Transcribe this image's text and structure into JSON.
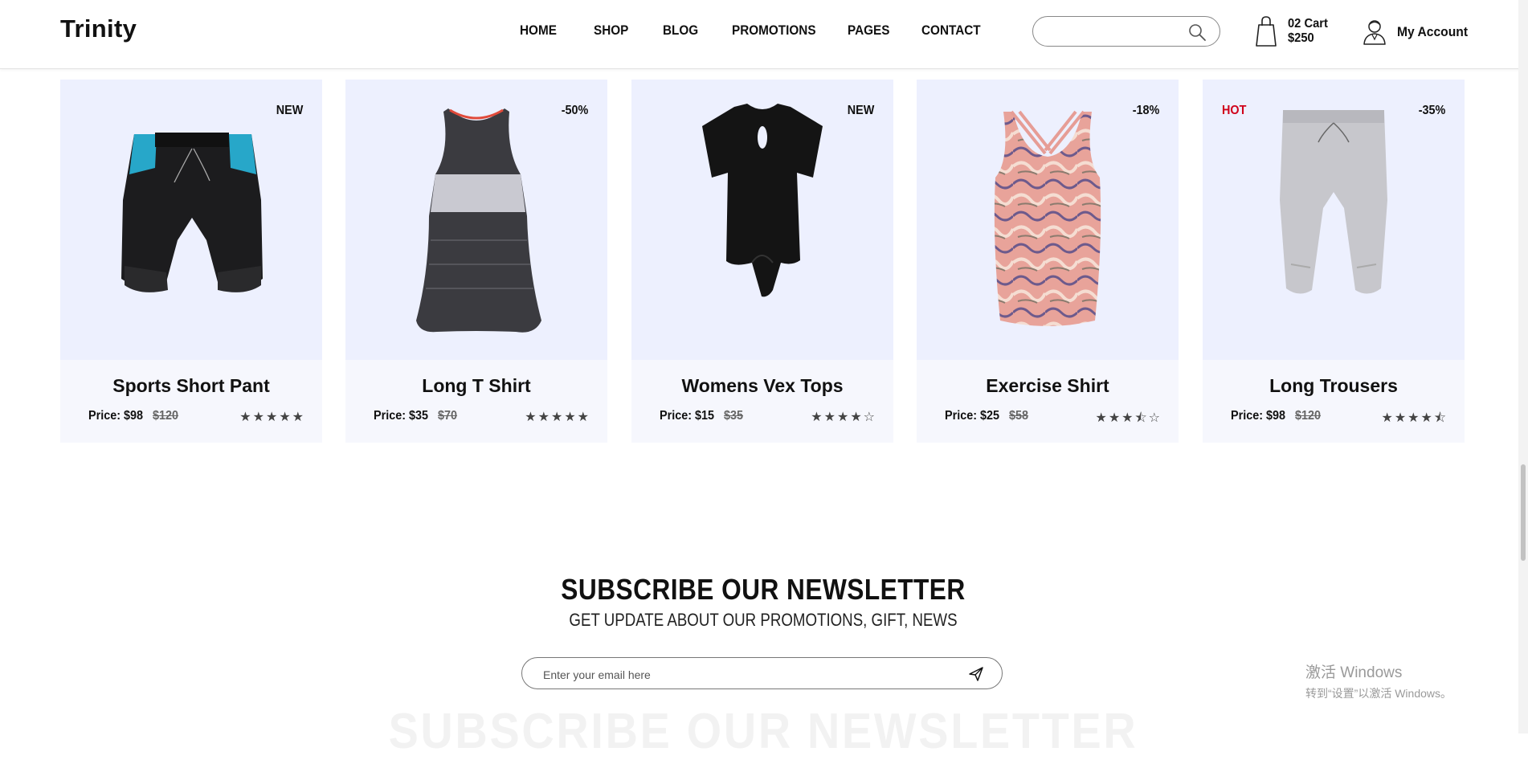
{
  "header": {
    "logo": "Trinity",
    "nav": [
      "HOME",
      "SHOP",
      "BLOG",
      "PROMOTIONS",
      "PAGES",
      "CONTACT"
    ],
    "search_placeholder": "",
    "cart_count": "02 Cart",
    "cart_total": "$250",
    "account_label": "My Account"
  },
  "products": [
    {
      "badge": "NEW",
      "badge_left": "",
      "name": "Sports Short Pant",
      "price": "Price: $98",
      "old_price": "$120",
      "rating": 5
    },
    {
      "badge": "-50%",
      "badge_left": "",
      "name": "Long T Shirt",
      "price": "Price: $35",
      "old_price": "$70",
      "rating": 5
    },
    {
      "badge": "NEW",
      "badge_left": "",
      "name": "Womens Vex Tops",
      "price": "Price: $15",
      "old_price": "$35",
      "rating": 4
    },
    {
      "badge": "-18%",
      "badge_left": "",
      "name": "Exercise Shirt",
      "price": "Price: $25",
      "old_price": "$58",
      "rating": 3.5
    },
    {
      "badge": "-35%",
      "badge_left": "HOT",
      "name": "Long Trousers",
      "price": "Price: $98",
      "old_price": "$120",
      "rating": 4.5
    }
  ],
  "newsletter": {
    "title": "SUBSCRIBE OUR NEWSLETTER",
    "subtitle": "GET UPDATE ABOUT OUR PROMOTIONS, GIFT, NEWS",
    "email_placeholder": "Enter your email here",
    "ghost_title": "SUBSCRIBE OUR NEWSLETTER"
  },
  "watermark": {
    "line1": "激活 Windows",
    "line2": "转到“设置”以激活 Windows。"
  },
  "colors": {
    "card_image_bg": "#edf0fe",
    "card_bg": "#f6f7fd",
    "hot_badge": "#d0021b"
  }
}
